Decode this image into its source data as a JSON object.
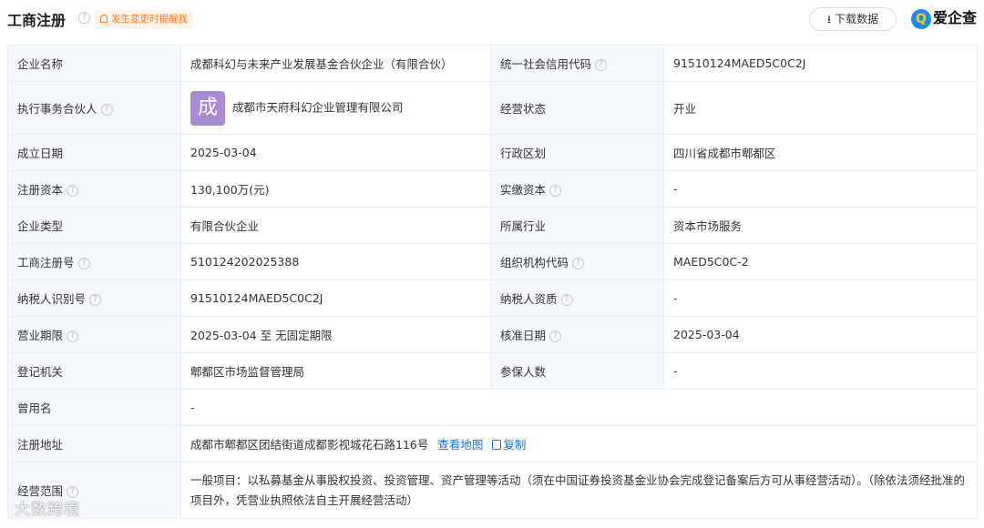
{
  "header": {
    "title": "工商注册",
    "alert_label": "发生变更时提醒我",
    "download_label": "下载数据",
    "logo_text": "爱企查",
    "help_glyph": "?"
  },
  "colors": {
    "accent_blue": "#1a6fd8",
    "alert_orange": "#ff7a22",
    "label_bg": "#f4f7fc",
    "avatar_purple": "#a98bd3"
  },
  "rows": {
    "r1": {
      "label1": "企业名称",
      "value1": "成都科幻与未来产业发展基金合伙企业（有限合伙）",
      "label2": "统一社会信用代码",
      "value2": "91510124MAED5C0C2J"
    },
    "r2": {
      "label1": "执行事务合伙人",
      "avatar": "成",
      "value1": "成都市天府科幻企业管理有限公司",
      "label2": "经营状态",
      "value2": "开业"
    },
    "r3": {
      "label1": "成立日期",
      "value1": "2025-03-04",
      "label2": "行政区划",
      "value2": "四川省成都市郫都区"
    },
    "r4": {
      "label1": "注册资本",
      "value1": "130,100万(元)",
      "label2": "实缴资本",
      "value2": "-"
    },
    "r5": {
      "label1": "企业类型",
      "value1": "有限合伙企业",
      "label2": "所属行业",
      "value2": "资本市场服务"
    },
    "r6": {
      "label1": "工商注册号",
      "value1": "510124202025388",
      "label2": "组织机构代码",
      "value2": "MAED5C0C-2"
    },
    "r7": {
      "label1": "纳税人识别号",
      "value1": "91510124MAED5C0C2J",
      "label2": "纳税人资质",
      "value2": "-"
    },
    "r8": {
      "label1": "营业期限",
      "value1": "2025-03-04 至 无固定期限",
      "label2": "核准日期",
      "value2": "2025-03-04"
    },
    "r9": {
      "label1": "登记机关",
      "value1": "郫都区市场监督管理局",
      "label2": "参保人数",
      "value2": "-"
    },
    "r10": {
      "label1": "曾用名",
      "value1": "-"
    },
    "r11": {
      "label1": "注册地址",
      "value1": "成都市郫都区团结街道成都影视城花石路116号",
      "map_link": "查看地图",
      "copy_link": "复制"
    },
    "r12": {
      "label1": "经营范围",
      "value1": "一般项目：以私募基金从事股权投资、投资管理、资产管理等活动（须在中国证券投资基金业协会完成登记备案后方可从事经营活动）。（除依法须经批准的项目外，凭营业执照依法自主开展经营活动）"
    }
  },
  "watermark": "大数跨境"
}
